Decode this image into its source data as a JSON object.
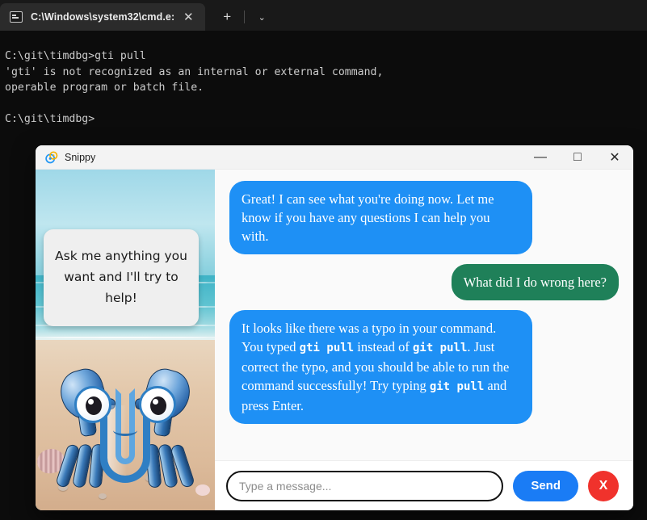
{
  "terminal": {
    "tab": {
      "icon": "console-icon",
      "title": "C:\\Windows\\system32\\cmd.e:",
      "close_label": "✕"
    },
    "new_tab_label": "+",
    "dropdown_label": "⌄",
    "console_text": "C:\\git\\timdbg>gti pull\n'gti' is not recognized as an internal or external command,\noperable program or batch file.\n\nC:\\git\\timdbg>"
  },
  "snippy": {
    "title": "Snippy",
    "window_controls": {
      "minimize": "—",
      "maximize": "□",
      "close": "✕"
    },
    "illustration": {
      "speech_text": "Ask me anything you want and I'll try to help!",
      "character": "paperclip-crab"
    },
    "messages": [
      {
        "sender": "bot",
        "html": "Great! I can see what you're doing now. Let me know if you have any questions I can help you with."
      },
      {
        "sender": "user",
        "html": "What did I do wrong here?"
      },
      {
        "sender": "bot",
        "html": "It looks like there was a typo in your command. You typed <code>gti pull</code> instead of <code>git pull</code>. Just correct the typo, and you should be able to run the command successfully! Try typing <code>git pull</code> and press Enter."
      }
    ],
    "composer": {
      "input_value": "",
      "input_placeholder": "Type a message...",
      "send_label": "Send",
      "cancel_label": "X"
    }
  },
  "colors": {
    "bot_bubble": "#1e90f5",
    "user_bubble": "#1f8059",
    "send_button": "#1a7cf5",
    "cancel_button": "#f0322c",
    "terminal_bg": "#0c0c0c"
  }
}
